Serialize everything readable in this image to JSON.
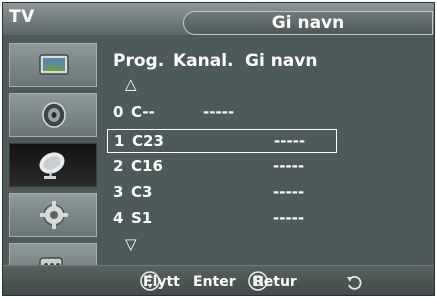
{
  "header": {
    "tv_label": "TV",
    "menu_title": "Gi navn"
  },
  "sidebar": {
    "items": [
      {
        "icon": "picture-icon"
      },
      {
        "icon": "sound-icon"
      },
      {
        "icon": "channel-icon",
        "active": true
      },
      {
        "icon": "setup-icon"
      },
      {
        "icon": "input-icon"
      }
    ]
  },
  "columns": {
    "prog": "Prog.",
    "kanal": "Kanal.",
    "gi_navn": "Gi navn"
  },
  "scroll": {
    "up": "△",
    "down": "▽"
  },
  "rows": [
    {
      "prog": "0",
      "channel": "C--",
      "name": "-----"
    },
    {
      "prog": "1",
      "channel": "C23",
      "name": "-----",
      "selected": true
    },
    {
      "prog": "2",
      "channel": "C16",
      "name": "-----"
    },
    {
      "prog": "3",
      "channel": "C3",
      "name": "-----"
    },
    {
      "prog": "4",
      "channel": "S1",
      "name": "-----"
    }
  ],
  "footer": {
    "move": "Flytt",
    "enter": "Enter",
    "return": "Retur"
  }
}
